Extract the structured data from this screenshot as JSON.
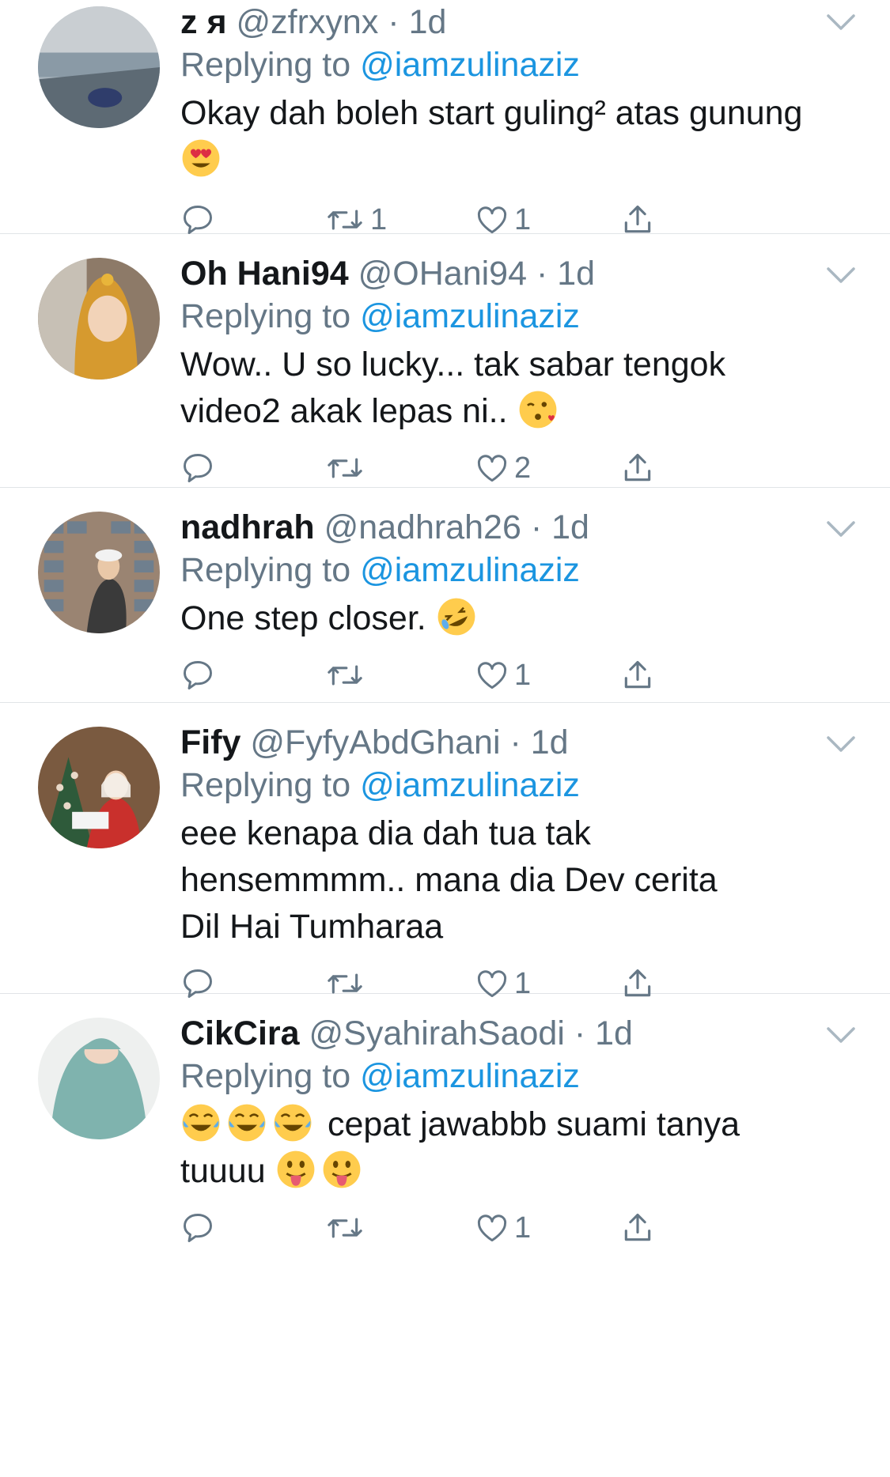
{
  "tweets": [
    {
      "name": "z я",
      "handle": "@zfrxynx",
      "dot": "·",
      "time": "1d",
      "replying_prefix": "Replying to",
      "replying_to": "@iamzulinaziz",
      "text": "Okay dah boleh start guling² atas gunung",
      "emojis_after": [
        "heart-eyes"
      ],
      "retweet_count": "1",
      "like_count": "1",
      "avatar_colors": [
        "#8a9aa6",
        "#c9ced2",
        "#4a5a6b"
      ]
    },
    {
      "name": "Oh Hani94",
      "handle": "@OHani94",
      "dot": "·",
      "time": "1d",
      "replying_prefix": "Replying to",
      "replying_to": "@iamzulinaziz",
      "text": "Wow.. U so lucky... tak sabar tengok video2 akak lepas ni..",
      "emojis_after": [
        "kiss-wink"
      ],
      "retweet_count": "",
      "like_count": "2",
      "avatar_colors": [
        "#d69a2f",
        "#f2d3b8",
        "#6b4a3a"
      ]
    },
    {
      "name": "nadhrah",
      "handle": "@nadhrah26",
      "dot": "·",
      "time": "1d",
      "replying_prefix": "Replying to",
      "replying_to": "@iamzulinaziz",
      "text": "One step closer.",
      "emojis_after": [
        "rofl"
      ],
      "retweet_count": "",
      "like_count": "1",
      "avatar_colors": [
        "#b08a6e",
        "#7a8a99",
        "#3a3a3a"
      ]
    },
    {
      "name": "Fify",
      "handle": "@FyfyAbdGhani",
      "dot": "·",
      "time": "1d",
      "replying_prefix": "Replying to",
      "replying_to": "@iamzulinaziz",
      "text": "eee kenapa dia dah tua tak hensemmmm.. mana dia Dev cerita Dil Hai Tumharaa",
      "emojis_after": [],
      "retweet_count": "",
      "like_count": "1",
      "avatar_colors": [
        "#6b4a30",
        "#c9302c",
        "#e8d9c8"
      ]
    },
    {
      "name": "CikCira",
      "handle": "@SyahirahSaodi",
      "dot": "·",
      "time": "1d",
      "replying_prefix": "Replying to",
      "replying_to": "@iamzulinaziz",
      "text_before": "cepat jawabbb suami tanya tuuuu",
      "emojis_before": [
        "joy",
        "joy",
        "joy"
      ],
      "emojis_after": [
        "tongue",
        "tongue"
      ],
      "retweet_count": "",
      "like_count": "1",
      "avatar_colors": [
        "#7fb3ae",
        "#f0d5c2",
        "#4f7f7a"
      ]
    }
  ],
  "icons": {
    "reply": "reply-icon",
    "retweet": "retweet-icon",
    "like": "heart-icon",
    "share": "share-icon",
    "caret": "chevron-down-icon"
  },
  "colors": {
    "name": "#14171a",
    "secondary": "#657786",
    "link": "#1b95e0",
    "divider": "#e1e4e7"
  }
}
